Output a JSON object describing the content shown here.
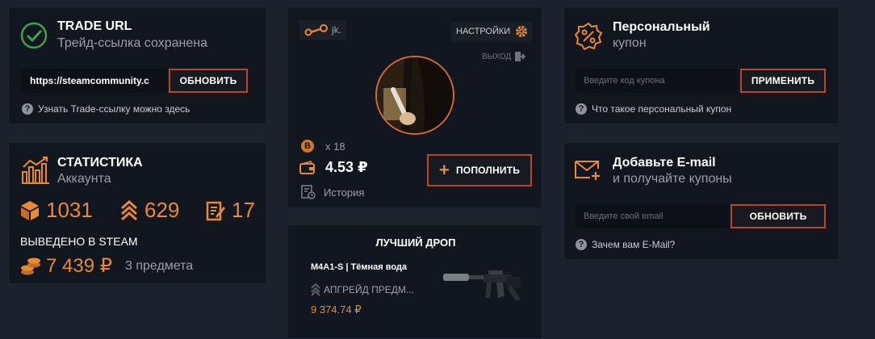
{
  "trade": {
    "title": "TRADE URL",
    "subtitle": "Трейд-ссылка сохранена",
    "url_value": "https://steamcommunity.c",
    "button": "ОБНОВИТЬ",
    "help": "Узнать Trade-ссылку можно здесь"
  },
  "stats": {
    "title": "СТАТИСТИКА",
    "subtitle": "Аккаунта",
    "boxes": "1031",
    "upgrades": "629",
    "contracts": "17",
    "withdrawn_label": "ВЫВЕДЕНО В STEAM",
    "withdrawn_amount": "7 439 ₽",
    "withdrawn_items": "3 предмета"
  },
  "profile": {
    "name": "jk.",
    "settings": "НАСТРОЙКИ",
    "logout": "ВЫХОД",
    "coins": "x 18",
    "balance": "4.53 ₽",
    "history": "История",
    "deposit": "ПОПОЛНИТЬ"
  },
  "best_drop": {
    "title": "ЛУЧШИЙ ДРОП",
    "item": "M4A1-S | Тёмная вода",
    "source": "АПГРЕЙД ПРЕДМ...",
    "price": "9 374.74 ₽"
  },
  "coupon": {
    "title": "Персональный",
    "subtitle": "купон",
    "placeholder": "Введите код купона",
    "button": "ПРИМЕНИТЬ",
    "help": "Что такое персональный купон"
  },
  "email": {
    "title": "Добавьте E-mail",
    "subtitle": "и получайте купоны",
    "placeholder": "Введите свой email",
    "button": "ОБНОВИТЬ",
    "help": "Зачем вам E-Mail?"
  },
  "colors": {
    "accent": "#e88a36",
    "button_border": "#b8452c",
    "card_bg": "#12161e",
    "page_bg": "#1b222d"
  }
}
